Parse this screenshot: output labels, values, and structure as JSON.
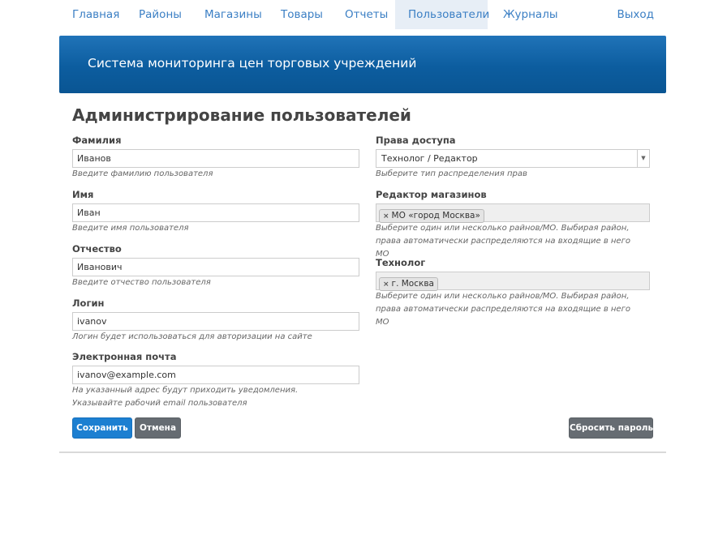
{
  "nav": {
    "items": [
      {
        "label": "Главная"
      },
      {
        "label": "Районы"
      },
      {
        "label": "Магазины"
      },
      {
        "label": "Товары"
      },
      {
        "label": "Отчеты"
      },
      {
        "label": "Пользователи",
        "active": true
      },
      {
        "label": "Журналы"
      }
    ],
    "logout": "Выход"
  },
  "banner": {
    "title": "Система мониторинга цен торговых учреждений"
  },
  "page": {
    "title": "Администрирование пользователей"
  },
  "form": {
    "last_name": {
      "label": "Фамилия",
      "value": "Иванов",
      "help": "Введите фамилию пользователя"
    },
    "first_name": {
      "label": "Имя",
      "value": "Иван",
      "help": "Введите имя пользователя"
    },
    "patronymic": {
      "label": "Отчество",
      "value": "Иванович",
      "help": "Введите отчество пользователя"
    },
    "login": {
      "label": "Логин",
      "value": "ivanov",
      "help": "Логин будет использоваться для авторизации на сайте"
    },
    "email": {
      "label": "Электронная почта",
      "value": "ivanov@example.com",
      "help": "На указанный адрес будут приходить уведомления. Указывайте рабочий email пользователя"
    },
    "access": {
      "label": "Права доступа",
      "value": "Технолог / Редактор",
      "help": "Выберите тип распределения прав"
    },
    "store_editor": {
      "label": "Редактор магазинов",
      "tags": [
        "МО «город Москва»"
      ],
      "help": "Выберите один или несколько райнов/МО. Выбирая район, права автоматически распределяются на входящие в него МО"
    },
    "technologist": {
      "label": "Технолог",
      "tags": [
        "г. Москва"
      ],
      "help": "Выберите один или несколько райнов/МО. Выбирая район, права автоматически распределяются на входящие в него МО"
    }
  },
  "buttons": {
    "save": "Сохранить",
    "cancel": "Отмена",
    "reset_password": "Сбросить пароль"
  },
  "colors": {
    "primary": "#1c7fd1",
    "secondary": "#666c72",
    "banner": "#0c5d9f",
    "link": "#3b7fc4"
  }
}
